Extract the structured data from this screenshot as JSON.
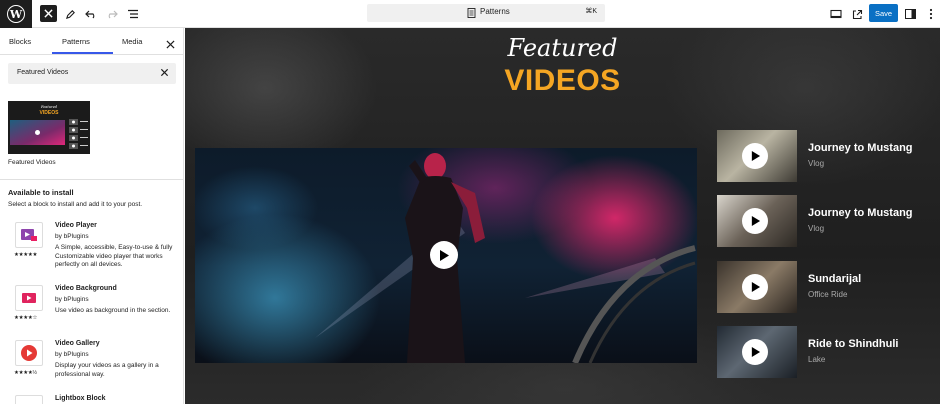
{
  "toolbar": {
    "command_label": "Patterns",
    "command_shortcut": "⌘K",
    "save_label": "Save"
  },
  "sidebar": {
    "tabs": [
      {
        "label": "Blocks"
      },
      {
        "label": "Patterns"
      },
      {
        "label": "Media"
      }
    ],
    "active_tab": "Patterns",
    "search_value": "Featured Videos",
    "pattern_caption": "Featured Videos",
    "available_title": "Available to install",
    "available_subtitle": "Select a block to install and add it to your post.",
    "plugins": [
      {
        "name": "Video Player",
        "author": "by bPlugins",
        "desc": "A Simple, accessible, Easy-to-use & fully Customizable video player that works perfectly on all devices.",
        "rating": 5,
        "icon": "video-player-icon"
      },
      {
        "name": "Video Background",
        "author": "by bPlugins",
        "desc": "Use video as background in the section.",
        "rating": 4,
        "icon": "video-background-icon"
      },
      {
        "name": "Video Gallery",
        "author": "by bPlugins",
        "desc": "Display your videos as a gallery in a professional way.",
        "rating": 4.5,
        "icon": "video-gallery-icon"
      },
      {
        "name": "Lightbox Block",
        "author": "",
        "desc": "",
        "rating": null,
        "icon": "lightbox-icon"
      }
    ]
  },
  "canvas": {
    "heading_script": "Featured",
    "heading_big": "VIDEOS",
    "accent_color": "#f5a623",
    "videos": [
      {
        "title": "Journey to Mustang",
        "subtitle": "Vlog"
      },
      {
        "title": "Journey to Mustang",
        "subtitle": "Vlog"
      },
      {
        "title": "Sundarijal",
        "subtitle": "Office Ride"
      },
      {
        "title": "Ride to Shindhuli",
        "subtitle": "Lake"
      }
    ]
  },
  "colors": {
    "primary_button": "#0a70c4",
    "tab_indicator": "#3858e9"
  }
}
